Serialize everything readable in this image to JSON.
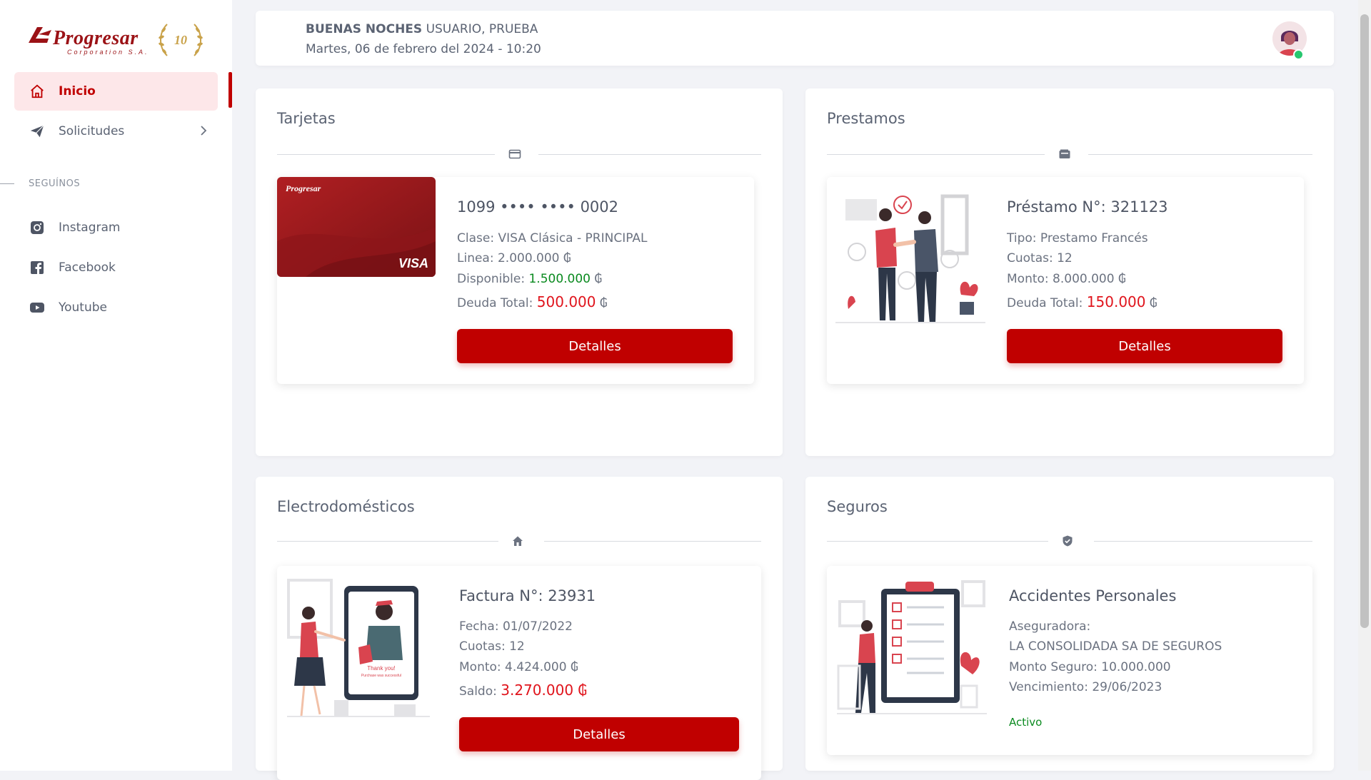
{
  "sidebar": {
    "logo": {
      "brand": "Progresar",
      "sub": "Corporation S.A.",
      "badge": "10"
    },
    "nav": [
      {
        "label": "Inicio",
        "icon": "home-icon",
        "active": true
      },
      {
        "label": "Solicitudes",
        "icon": "send-icon",
        "has_submenu": true
      }
    ],
    "section_label": "SEGUÍNOS",
    "social": [
      {
        "label": "Instagram",
        "icon": "instagram-icon"
      },
      {
        "label": "Facebook",
        "icon": "facebook-icon"
      },
      {
        "label": "Youtube",
        "icon": "youtube-icon"
      }
    ]
  },
  "header": {
    "greeting_bold": "BUENAS NOCHES",
    "greeting_name": " USUARIO, PRUEBA",
    "date": "Martes, 06 de febrero del 2024 - 10:20"
  },
  "tarjetas": {
    "title": "Tarjetas",
    "card_brand": "Progresar",
    "card_network": "VISA",
    "number": "1099 •••• •••• 0002",
    "clase": "Clase: VISA Clásica - PRINCIPAL",
    "linea": "Linea: 2.000.000 ₲",
    "disponible_label": "Disponible: ",
    "disponible_value": "1.500.000",
    "disponible_currency": " ₲",
    "deuda_label": "Deuda Total: ",
    "deuda_value": "500.000",
    "deuda_currency": " ₲",
    "button": "Detalles"
  },
  "prestamos": {
    "title": "Prestamos",
    "heading": "Préstamo N°: 321123",
    "tipo": "Tipo: Prestamo Francés",
    "cuotas": "Cuotas: 12",
    "monto": "Monto: 8.000.000 ₲",
    "deuda_label": "Deuda Total: ",
    "deuda_value": "150.000",
    "deuda_currency": " ₲",
    "button": "Detalles"
  },
  "electro": {
    "title": "Electrodomésticos",
    "heading": "Factura N°: 23931",
    "fecha": "Fecha: 01/07/2022",
    "cuotas": "Cuotas: 12",
    "monto": "Monto: 4.424.000 ₲",
    "saldo_label": "Saldo: ",
    "saldo_value": "3.270.000 ₲",
    "illus_text1": "Thank you!",
    "illus_text2": "Purchase was successful",
    "button": "Detalles"
  },
  "seguros": {
    "title": "Seguros",
    "heading": "Accidentes Personales",
    "aseguradora_label": "Aseguradora:",
    "aseguradora": "LA CONSOLIDADA SA DE SEGUROS",
    "monto": "Monto Seguro: 10.000.000",
    "vencimiento": "Vencimiento: 29/06/2023",
    "status": "Activo"
  },
  "colors": {
    "accent": "#c00000",
    "accent_soft": "#fde7e9",
    "positive": "#0a8a1f",
    "debt": "#e0141c"
  }
}
